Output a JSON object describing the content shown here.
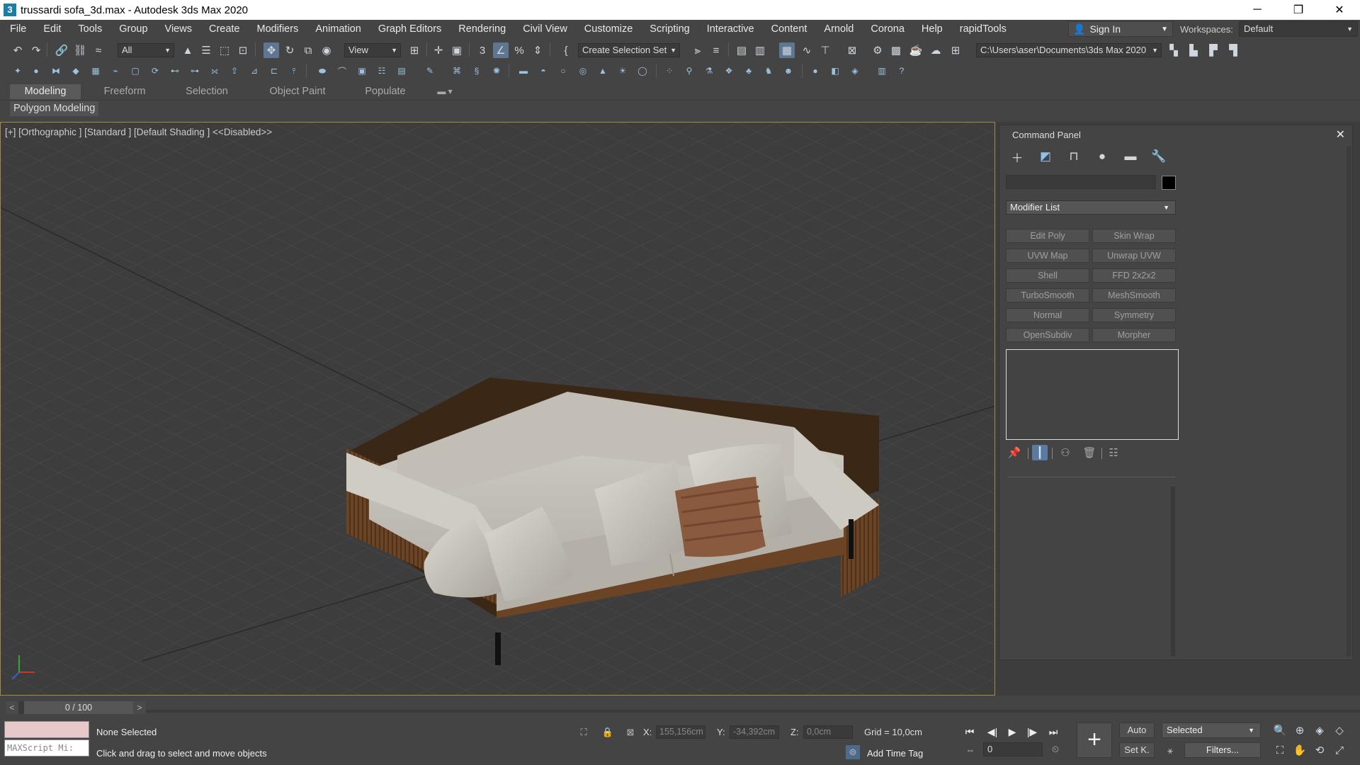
{
  "window": {
    "title": "trussardi sofa_3d.max - Autodesk 3ds Max 2020",
    "app_icon": "3",
    "minimize": "─",
    "restore": "❐",
    "close": "✕"
  },
  "menu": {
    "items": [
      "File",
      "Edit",
      "Tools",
      "Group",
      "Views",
      "Create",
      "Modifiers",
      "Animation",
      "Graph Editors",
      "Rendering",
      "Civil View",
      "Customize",
      "Scripting",
      "Interactive",
      "Content",
      "Arnold",
      "Corona",
      "Help",
      "rapidTools"
    ],
    "sign_in": "Sign In",
    "workspaces_label": "Workspaces:",
    "workspace": "Default"
  },
  "toolbar": {
    "selection_filter": "All",
    "ref_coord": "View",
    "named_selection": "Create Selection Set",
    "project_path": "C:\\Users\\aser\\Documents\\3ds Max 2020"
  },
  "ribbon": {
    "tabs": [
      "Modeling",
      "Freeform",
      "Selection",
      "Object Paint",
      "Populate"
    ],
    "active_tab": "Modeling",
    "sub_label": "Polygon Modeling"
  },
  "viewport": {
    "label": "[+] [Orthographic ] [Standard ] [Default Shading ]  <<Disabled>>"
  },
  "command_panel": {
    "title": "Command Panel",
    "close": "✕",
    "object_color": "#000000",
    "modifier_list": "Modifier List",
    "modifiers": [
      "Edit Poly",
      "Skin Wrap",
      "UVW Map",
      "Unwrap UVW",
      "Shell",
      "FFD 2x2x2",
      "TurboSmooth",
      "MeshSmooth",
      "Normal",
      "Symmetry",
      "OpenSubdiv",
      "Morpher"
    ]
  },
  "timeline": {
    "frame_display": "0 / 100",
    "prev": "<",
    "next": ">"
  },
  "status": {
    "maxscript_placeholder": "MAXScript Mi:",
    "selection": "None Selected",
    "prompt": "Click and drag to select and move objects",
    "x_label": "X:",
    "x_value": "155,156cm",
    "y_label": "Y:",
    "y_value": "-34,392cm",
    "z_label": "Z:",
    "z_value": "0,0cm",
    "grid": "Grid = 10,0cm",
    "add_time_tag": "Add Time Tag",
    "frame": "0",
    "auto_key": "Auto",
    "set_key": "Set K.",
    "key_mode": "Selected",
    "filters": "Filters..."
  },
  "colors": {
    "viewport_bg": "#3d3d3d",
    "viewport_border": "#a88c3d",
    "sofa_cushion": "#c9c5bc",
    "sofa_wood": "#6b4426",
    "pillow_accent": "#8a5a3e",
    "active_blue": "#5f7691"
  }
}
